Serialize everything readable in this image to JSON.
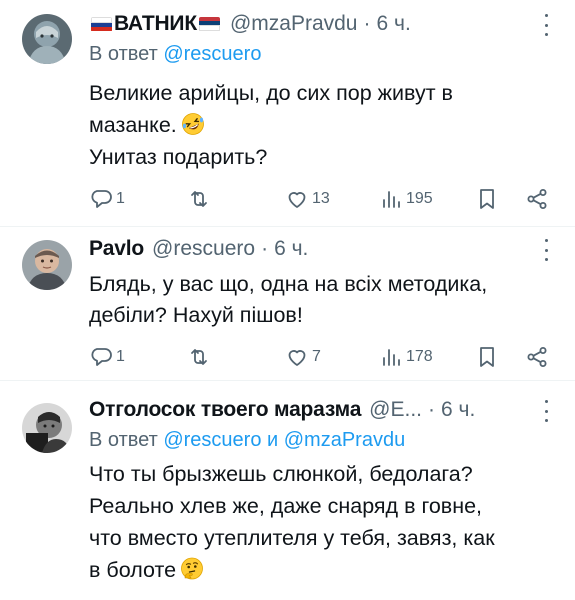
{
  "tweets": [
    {
      "name": "ВАТНИК",
      "handle": "@mzaPravdu",
      "dot": "·",
      "time": "6 ч.",
      "reply_prefix": "В ответ",
      "reply_links": [
        "@rescuero"
      ],
      "reply_joiner": "",
      "lines": [
        "Великие арийцы, до сих пор живут в",
        "мазанке.",
        "Унитаз подарить?"
      ],
      "emoji": "rolling-on-floor-laughing-emoji",
      "stats": {
        "replies": "1",
        "retweets": "",
        "likes": "13",
        "views": "195"
      }
    },
    {
      "name": "Pavlo",
      "handle": "@rescuero",
      "dot": "·",
      "time": "6 ч.",
      "lines": [
        "Блядь, у вас що, одна на всіх методика,",
        "дебіли? Нахуй пішов!"
      ],
      "stats": {
        "replies": "1",
        "retweets": "",
        "likes": "7",
        "views": "178"
      }
    },
    {
      "name": "Отголосок твоего маразма",
      "handle": "@E...",
      "dot": "·",
      "time": "6 ч.",
      "reply_prefix": "В ответ",
      "reply_links": [
        "@rescuero",
        "@mzaPravdu"
      ],
      "reply_joiner": "и",
      "lines": [
        "Что ты брызжешь слюнкой, бедолага?",
        "Реально хлев же, даже снаряд в говне,",
        "что вместо утеплителя у тебя,  завяз, как",
        "в болоте"
      ],
      "emoji": "thinking-face-emoji"
    }
  ],
  "colors": {
    "text": "#0f1419",
    "secondary": "#536471",
    "link": "#1d9bf0",
    "divider": "#eff3f4",
    "flag_russia": [
      "#ffffff",
      "#1c3f94",
      "#d52b1e"
    ],
    "flag_serbia": [
      "#c6363c",
      "#0c4076",
      "#ffffff"
    ]
  }
}
